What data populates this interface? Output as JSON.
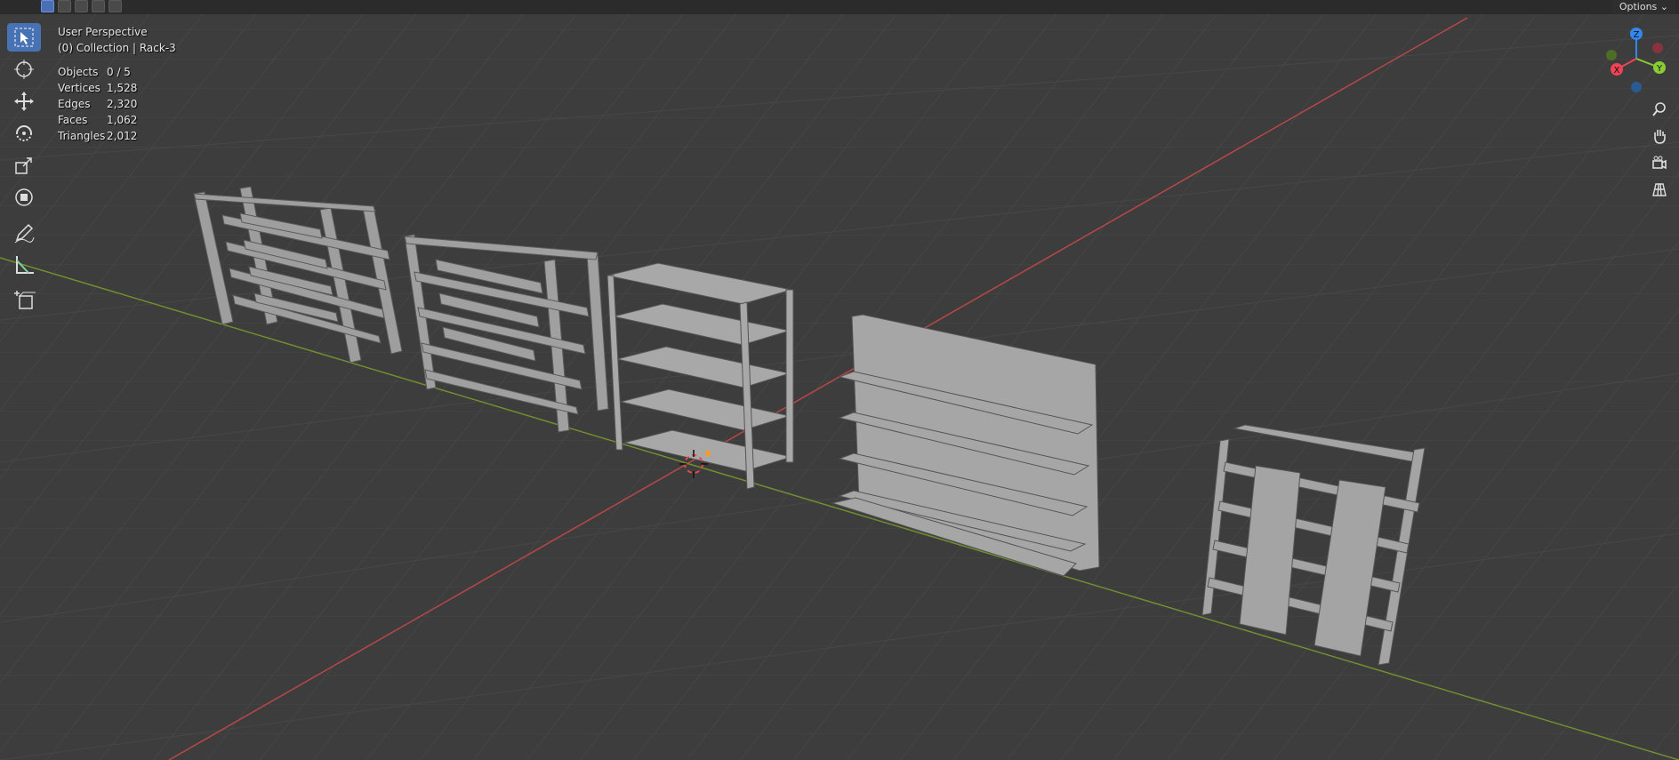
{
  "viewport": {
    "view_name": "User Perspective",
    "collection_label": "(0) Collection | Rack-3"
  },
  "stats": [
    {
      "label": "Objects",
      "value": "0 / 5"
    },
    {
      "label": "Vertices",
      "value": "1,528"
    },
    {
      "label": "Edges",
      "value": "2,320"
    },
    {
      "label": "Faces",
      "value": "1,062"
    },
    {
      "label": "Triangles",
      "value": "2,012"
    }
  ],
  "header": {
    "options_label": "Options",
    "options_icon": "chevron-down-icon"
  },
  "toolbar": {
    "tools": [
      {
        "name": "select-tool",
        "icon": "cursor-arrow-icon",
        "active": true
      },
      {
        "name": "cursor-tool",
        "icon": "crosshair-circle-icon",
        "active": false
      },
      {
        "name": "move-tool",
        "icon": "move-arrows-icon",
        "active": false
      },
      {
        "name": "rotate-tool",
        "icon": "rotate-icon",
        "active": false
      },
      {
        "name": "scale-tool",
        "icon": "scale-icon",
        "active": false
      },
      {
        "name": "transform-tool",
        "icon": "transform-icon",
        "active": false
      },
      {
        "name": "annotate-tool",
        "icon": "pencil-icon",
        "active": false
      },
      {
        "name": "measure-tool",
        "icon": "ruler-icon",
        "active": false
      },
      {
        "name": "add-cube-tool",
        "icon": "add-cube-icon",
        "active": false
      }
    ]
  },
  "gizmo": {
    "axes": [
      "X",
      "Y",
      "Z"
    ],
    "colors": {
      "x": "#ee4455",
      "y": "#88cc33",
      "z": "#3388ee"
    }
  },
  "nav": [
    {
      "name": "zoom-button",
      "icon": "magnifier-icon"
    },
    {
      "name": "pan-button",
      "icon": "hand-icon"
    },
    {
      "name": "camera-button",
      "icon": "camera-icon"
    },
    {
      "name": "ortho-toggle-button",
      "icon": "grid-icon"
    }
  ],
  "colors": {
    "background": "#3d3d3d",
    "grid": "#484848",
    "x_axis": "#b84848",
    "y_axis": "#6f8f2f",
    "object": "#a8a8a8",
    "accent": "#4772b3"
  }
}
